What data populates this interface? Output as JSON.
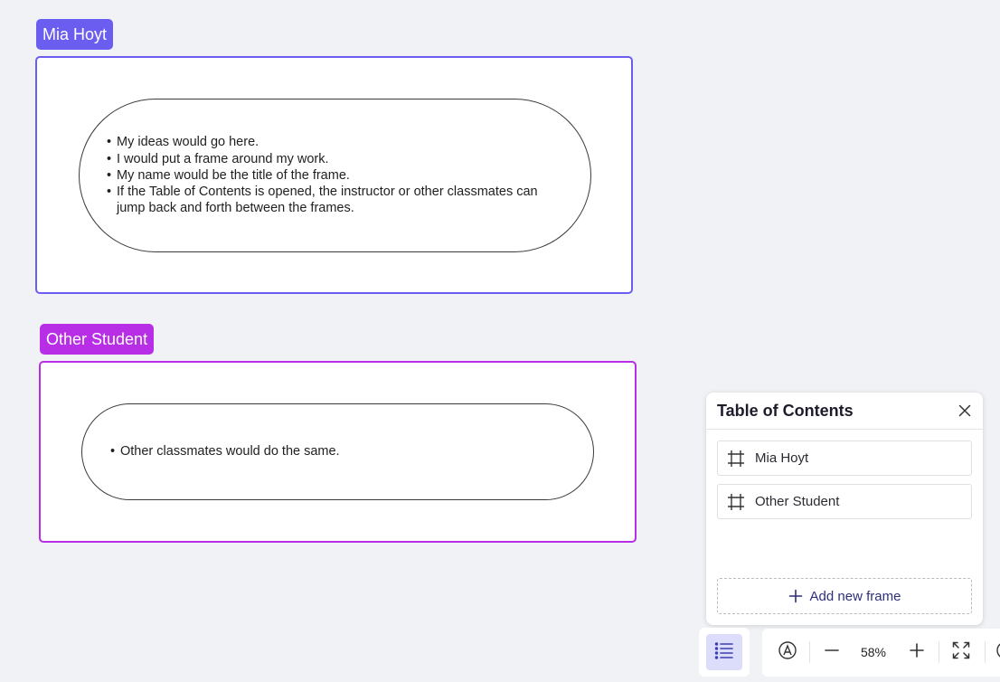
{
  "frames": [
    {
      "label": "Mia Hoyt",
      "color": "#6c5df1",
      "bullets": [
        "My ideas would go here.",
        "I would put a frame around my work.",
        "My name would be the title of the frame.",
        "If the Table of Contents is opened, the instructor or other classmates can jump back and forth between the frames."
      ]
    },
    {
      "label": "Other Student",
      "color": "#b82ee6",
      "bullets": [
        "Other classmates would do the same."
      ]
    }
  ],
  "toc": {
    "title": "Table of Contents",
    "items": [
      {
        "label": "Mia Hoyt",
        "icon": "frame-icon"
      },
      {
        "label": "Other Student",
        "icon": "frame-icon"
      }
    ],
    "add_label": "Add new frame",
    "close_icon": "close-icon"
  },
  "toolbar": {
    "toc_toggle_icon": "list-icon",
    "style_icon": "pen-circle-icon",
    "zoom_out_icon": "minus-icon",
    "zoom_level": "58%",
    "zoom_in_icon": "plus-icon",
    "fit_icon": "fit-screen-icon"
  },
  "colors": {
    "canvas": "#f1f2f5",
    "toggle_active": "#dcdcfb",
    "add_text": "#2e2f7a"
  }
}
